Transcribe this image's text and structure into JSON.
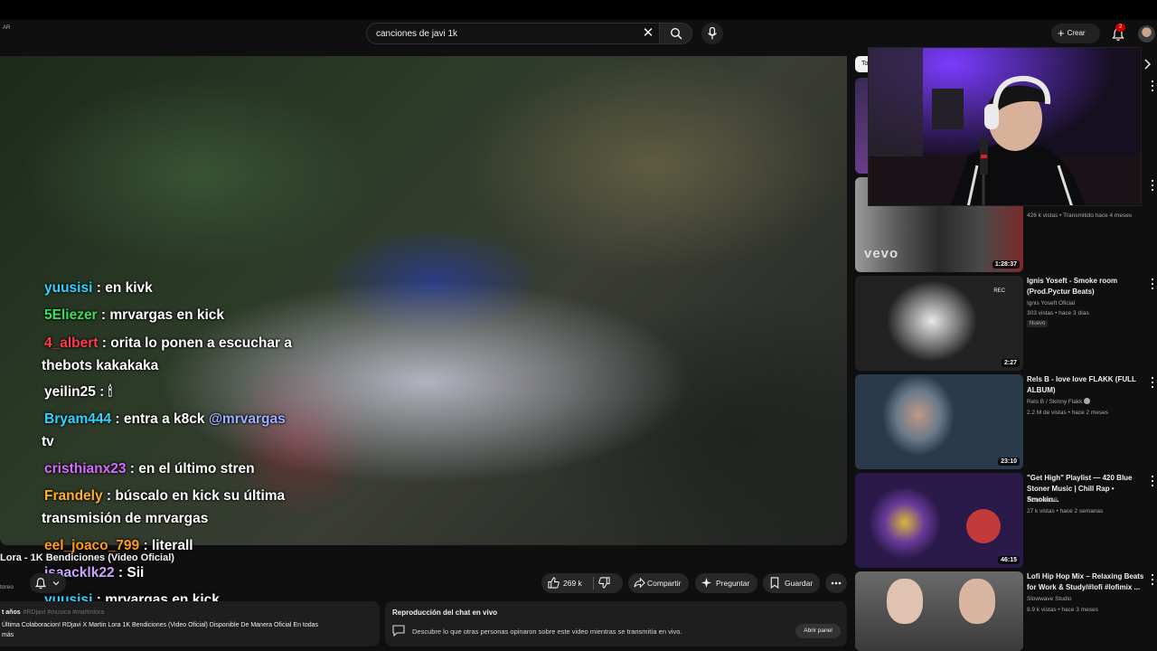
{
  "header": {
    "country_code": "AR",
    "search_value": "canciones de javi 1k",
    "create_label": "Crear",
    "notification_count": "2"
  },
  "chat_messages": [
    {
      "user": "yuusisi",
      "user_color": "#2fd4ff",
      "text": " : en kivk"
    },
    {
      "user": "5Eliezer",
      "user_color": "#3ddc5a",
      "text": " : mrvargas en kick"
    },
    {
      "user": "4_albert",
      "user_color": "#ff3b4a",
      "text": " : orita lo ponen a escuchar a",
      "text2": "thebots kakakaka"
    },
    {
      "user": "yeilin25",
      "user_color": "#ffffff",
      "text": " : ",
      "emoji": "🕯"
    },
    {
      "user": "Bryam444",
      "user_color": "#2fd4ff",
      "text": " : entra a k8ck ",
      "mention": "@mrvargas",
      "text2": "tv"
    },
    {
      "user": "cristhianx23",
      "user_color": "#d66bff",
      "text": " : en el último stren"
    },
    {
      "user": "Frandely",
      "user_color": "#ffb02e",
      "text": " : búscalo en kick su última",
      "text2": "transmisión de mrvargas"
    },
    {
      "user": "eel_joaco_799",
      "user_color": "#ff9a1f",
      "text": " : literall"
    },
    {
      "user": "isaacklk22",
      "user_color": "#c9a6ff",
      "text": " : Sii"
    },
    {
      "user": "yuusisi",
      "user_color": "#2fd4ff",
      "text": " : mrvargas en kick"
    }
  ],
  "video": {
    "title": "Lora - 1K Bendiciones (Video Oficial)",
    "channel_fragment": "toreo",
    "likes": "269 k",
    "share_label": "Compartir",
    "ask_label": "Preguntar",
    "save_label": "Guardar"
  },
  "description": {
    "meta": "t años",
    "tags": "#RDjavi #musica #martinlora",
    "text": "Última Colaboracion! RDjavi X Martin Lora 1K Bendiciones (Video Oficial) Disponible De Manera Oficial En todas",
    "more": "más"
  },
  "live_chat_panel": {
    "title": "Reproducción del chat en vivo",
    "text": "Descubre lo que otras personas opinaron sobre este video mientras se transmitía en vivo.",
    "button": "Abrir panel"
  },
  "sidebar": {
    "chip_label": "To",
    "recommendations": [
      {
        "title": "",
        "channel": "",
        "meta": "426 k vistas • Transmitido hace 4 meses",
        "duration": "1:28:37",
        "badge": "",
        "thumb_text": "vevo"
      },
      {
        "title": "Ignis Yoseft - Smoke room (Prod.Pyctur Beats)",
        "channel": "Ignis Yoseft Oficial",
        "meta": "303 vistas • hace 3 días",
        "duration": "2:27",
        "badge": "Nuevo",
        "thumb_text": "REC"
      },
      {
        "title": "Rels B - love love FLAKK (FULL ALBUM)",
        "channel": "Rels B / Skinny Flakk",
        "meta": "2.2 M de vistas • hace 2 meses",
        "duration": "23:10",
        "badge": "",
        "thumb_text": ""
      },
      {
        "title": "\"Get High\" Playlist — 420 Blue Stoner Music | Chill Rap • Smokin...",
        "channel": "StonedBOB",
        "meta": "27 k vistas • hace 2 semanas",
        "duration": "46:15",
        "badge": "",
        "thumb_text": ""
      },
      {
        "title": "Lofi Hip Hop Mix – Relaxing Beats for Work & Study/#lofi #lofimix ...",
        "channel": "Slowwave Studio",
        "meta": "8.9 k vistas • hace 3 meses",
        "duration": "",
        "badge": "",
        "thumb_text": ""
      }
    ]
  },
  "colors": {
    "background": "#0f0f0f",
    "surface": "#272727",
    "accent_red": "#cc0000"
  },
  "icons": [
    "search-icon",
    "clear-icon",
    "mic-icon",
    "plus-icon",
    "bell-icon",
    "like-icon",
    "dislike-icon",
    "share-icon",
    "sparkle-icon",
    "save-icon",
    "more-icon",
    "chat-icon",
    "chevron-right-icon"
  ]
}
